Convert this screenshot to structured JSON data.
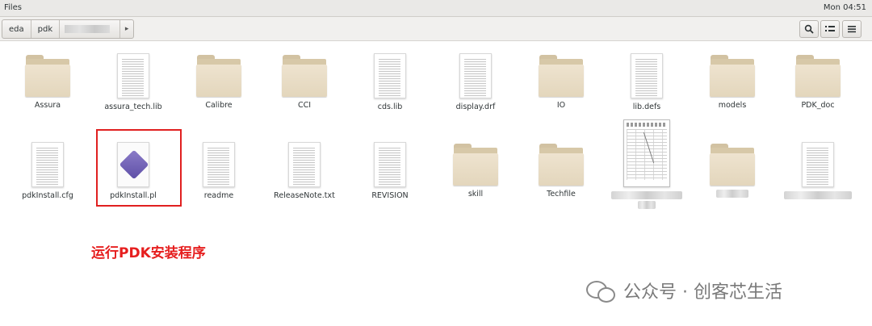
{
  "topbar": {
    "app_name": "Files",
    "clock": "Mon 04:51"
  },
  "pathbar": {
    "crumbs": [
      "eda",
      "pdk"
    ],
    "next_icon": "chevron-right-icon",
    "buttons": {
      "search_icon": "search-icon",
      "view_icon": "view-options-icon",
      "menu_icon": "menu-icon"
    }
  },
  "files": [
    {
      "name": "Assura",
      "type": "folder"
    },
    {
      "name": "assura_tech.lib",
      "type": "text"
    },
    {
      "name": "Calibre",
      "type": "folder"
    },
    {
      "name": "CCI",
      "type": "folder"
    },
    {
      "name": "cds.lib",
      "type": "text"
    },
    {
      "name": "display.drf",
      "type": "text"
    },
    {
      "name": "IO",
      "type": "folder"
    },
    {
      "name": "lib.defs",
      "type": "text"
    },
    {
      "name": "models",
      "type": "folder"
    },
    {
      "name": "PDK_doc",
      "type": "folder"
    },
    {
      "name": "pdkInstall.cfg",
      "type": "text"
    },
    {
      "name": "pdkInstall.pl",
      "type": "perl"
    },
    {
      "name": "readme",
      "type": "text"
    },
    {
      "name": "ReleaseNote.txt",
      "type": "text"
    },
    {
      "name": "REVISION",
      "type": "text"
    },
    {
      "name": "skill",
      "type": "folder"
    },
    {
      "name": "Techfile",
      "type": "folder"
    }
  ],
  "annotation": "运行PDK安装程序",
  "watermark": "公众号 · 创客芯生活"
}
